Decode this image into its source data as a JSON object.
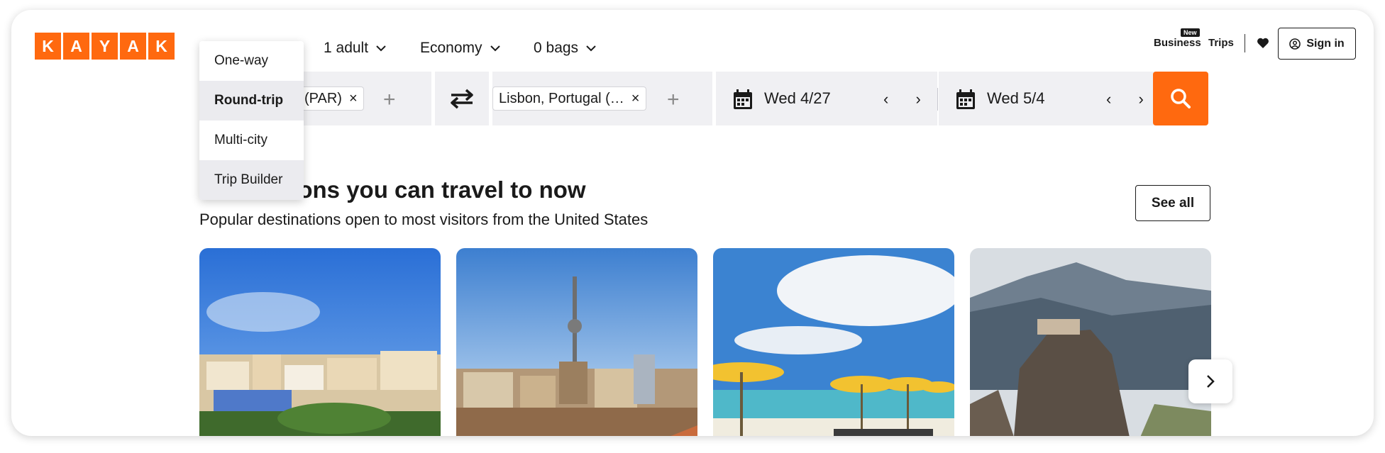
{
  "brand": {
    "letters": [
      "K",
      "A",
      "Y",
      "A",
      "K"
    ],
    "color": "#ff690f"
  },
  "options": {
    "travelers": "1 adult",
    "cabin": "Economy",
    "bags": "0 bags"
  },
  "trip_type_menu": {
    "items": [
      "One-way",
      "Round-trip",
      "Multi-city",
      "Trip Builder"
    ],
    "selected": "Round-trip"
  },
  "nav": {
    "business": "Business",
    "new_badge": "New",
    "trips": "Trips",
    "sign_in": "Sign in"
  },
  "search": {
    "origin_chip": "(PAR)",
    "destination_chip": "Lisbon, Portugal (…",
    "depart_date": "Wed 4/27",
    "return_date": "Wed 5/4",
    "remove_symbol": "×",
    "add_symbol": "+",
    "prev_next": "‹ ›"
  },
  "section": {
    "title": "Destinations you can travel to now",
    "subtitle": "Popular destinations open to most visitors from the United States",
    "see_all": "See all"
  },
  "cards": [
    {
      "icon": "lisbon-photo"
    },
    {
      "icon": "berlin-photo"
    },
    {
      "icon": "beach-photo"
    },
    {
      "icon": "meteora-photo"
    }
  ],
  "colors": {
    "accent": "#ff690f",
    "field_bg": "#f0f0f3"
  }
}
